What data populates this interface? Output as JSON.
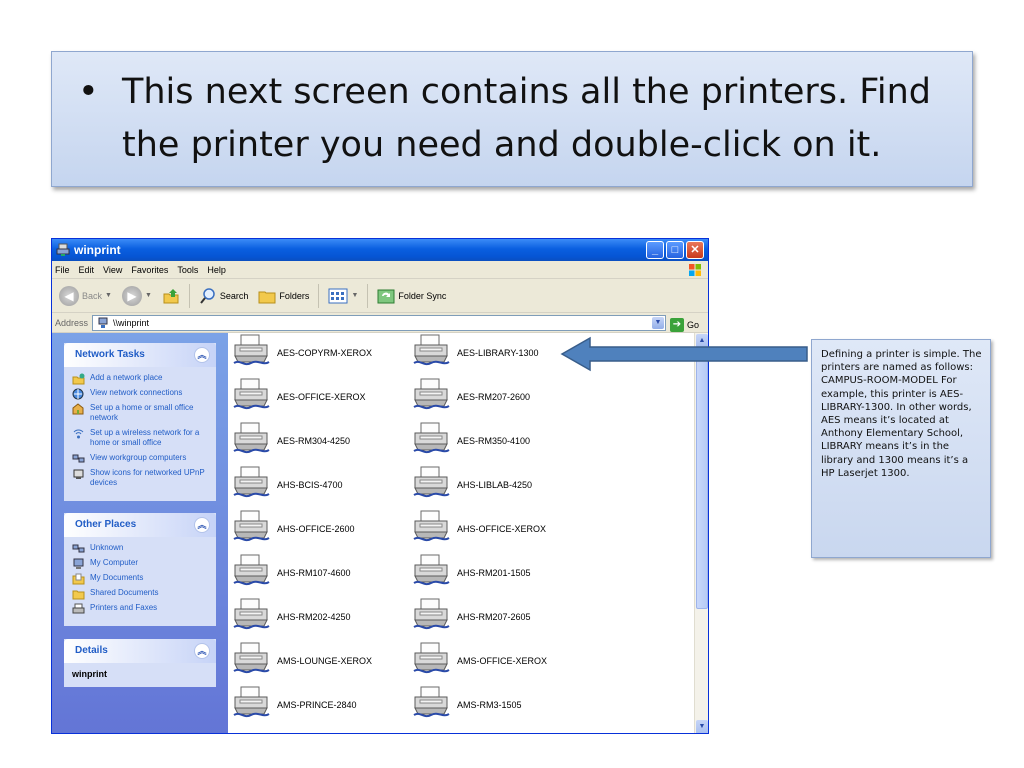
{
  "slide": {
    "bullet": "•",
    "text": "This next screen contains all the printers.  Find the printer you need and double-click on it."
  },
  "window": {
    "title": "winprint",
    "menu": [
      "File",
      "Edit",
      "View",
      "Favorites",
      "Tools",
      "Help"
    ],
    "toolbar": {
      "back": "Back",
      "search": "Search",
      "folders": "Folders",
      "folder_sync": "Folder Sync"
    },
    "address": {
      "label": "Address",
      "value": "\\\\winprint",
      "go": "Go"
    },
    "panels": {
      "network_tasks": {
        "title": "Network Tasks",
        "items": [
          "Add a network place",
          "View network connections",
          "Set up a home or small office network",
          "Set up a wireless network for a home or small office",
          "View workgroup computers",
          "Show icons for networked UPnP devices"
        ]
      },
      "other_places": {
        "title": "Other Places",
        "items": [
          "Unknown",
          "My Computer",
          "My Documents",
          "Shared Documents",
          "Printers and Faxes"
        ]
      },
      "details": {
        "title": "Details",
        "name": "winprint"
      }
    },
    "printers": [
      "AES-COPYRM-XEROX",
      "AES-LIBRARY-1300",
      "AES-OFFICE-XEROX",
      "AES-RM207-2600",
      "AES-RM304-4250",
      "AES-RM350-4100",
      "AHS-BCIS-4700",
      "AHS-LIBLAB-4250",
      "AHS-OFFICE-2600",
      "AHS-OFFICE-XEROX",
      "AHS-RM107-4600",
      "AHS-RM201-1505",
      "AHS-RM202-4250",
      "AHS-RM207-2605",
      "AMS-LOUNGE-XEROX",
      "AMS-OFFICE-XEROX",
      "AMS-PRINCE-2840",
      "AMS-RM3-1505"
    ]
  },
  "callout": {
    "text": "Defining a printer is simple.  The printers are named as follows: CAMPUS-ROOM-MODEL For example, this printer is AES-LIBRARY-1300.  In other words, AES means it’s located at Anthony Elementary School, LIBRARY means it’s in the library and 1300 means it’s a HP Laserjet 1300."
  },
  "colors": {
    "slide_fill": "#c5d5ef",
    "xp_title_blue": "#0a5fe0",
    "task_pane": "#6375d6",
    "arrow_fill": "#4f81bd"
  }
}
